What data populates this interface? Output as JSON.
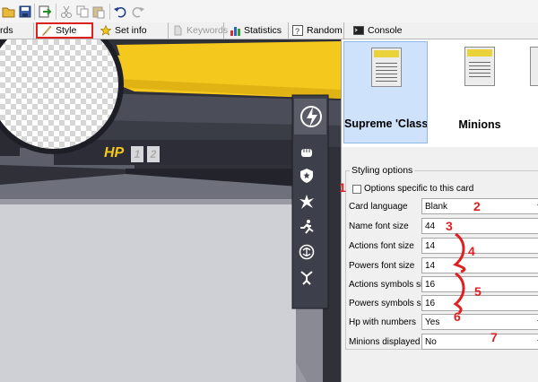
{
  "tabs": {
    "cards": "rds",
    "style": "Style",
    "set_info": "Set info",
    "keywords": "Keywords",
    "statistics": "Statistics",
    "random": "Random",
    "console": "Console"
  },
  "card": {
    "hp_label": "HP",
    "hp_boxes": [
      "1",
      "2"
    ]
  },
  "thumbnails": [
    {
      "label": "Supreme 'Classi"
    },
    {
      "label": "Minions"
    }
  ],
  "styling": {
    "legend": "Styling options",
    "specific_checkbox": {
      "label": "Options specific to this card",
      "checked": false
    },
    "fields": [
      {
        "label": "Card language",
        "value": "Blank"
      },
      {
        "label": "Name font size",
        "value": "44"
      },
      {
        "label": "Actions font size",
        "value": "14"
      },
      {
        "label": "Powers font size",
        "value": "14"
      },
      {
        "label": "Actions symbols size",
        "value": "16"
      },
      {
        "label": "Powers symbols size",
        "value": "16"
      },
      {
        "label": "Hp with numbers",
        "value": "Yes"
      },
      {
        "label": "Minions displayed",
        "value": "No"
      }
    ]
  },
  "annotations": [
    "1",
    "2",
    "3",
    "4",
    "5",
    "6",
    "7"
  ],
  "colors": {
    "highlight": "#e02020",
    "card_yellow": "#f5c81e",
    "card_dark": "#3d3f4a",
    "selected_thumb": "#cfe2fb"
  }
}
